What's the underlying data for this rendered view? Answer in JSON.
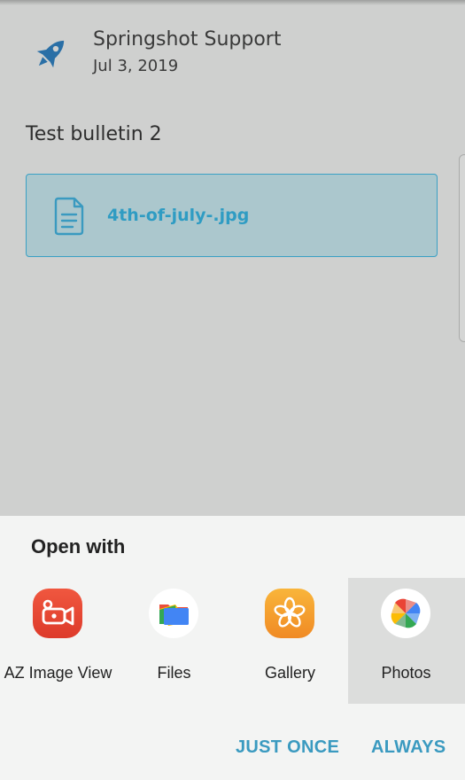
{
  "post": {
    "sender": "Springshot Support",
    "date": "Jul 3, 2019",
    "message": "Test bulletin 2",
    "attachment": {
      "filename": "4th-of-july-.jpg"
    }
  },
  "open_with": {
    "title": "Open with",
    "apps": [
      {
        "label": "AZ Image View",
        "icon": "video-camera-icon",
        "selected": false
      },
      {
        "label": "Files",
        "icon": "files-icon",
        "selected": false
      },
      {
        "label": "Gallery",
        "icon": "gallery-flower-icon",
        "selected": false
      },
      {
        "label": "Photos",
        "icon": "photos-pinwheel-icon",
        "selected": true
      }
    ],
    "buttons": {
      "just_once": "JUST ONCE",
      "always": "ALWAYS"
    }
  },
  "colors": {
    "accent": "#3a9ac0",
    "rocket": "#2a6fa6",
    "az_red": "#e94a35",
    "gallery_orange": "#f7a02f"
  }
}
